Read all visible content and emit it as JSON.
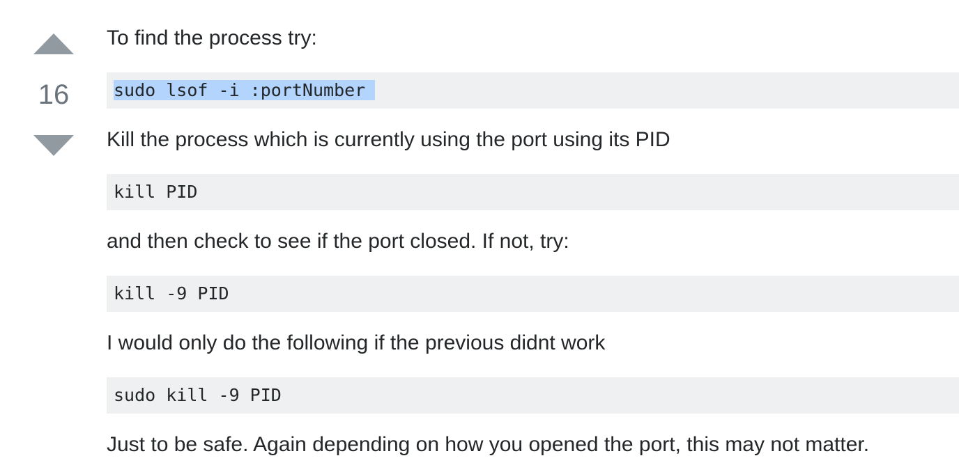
{
  "vote": {
    "score": "16",
    "up_icon": "triangle-up",
    "down_icon": "triangle-down"
  },
  "post": {
    "p1": "To find the process try:",
    "code1": "sudo lsof -i :portNumber",
    "p2": "Kill the process which is currently using the port using its PID",
    "code2": "kill PID",
    "p3": "and then check to see if the port closed. If not, try:",
    "code3": "kill -9 PID",
    "p4": "I would only do the following if the previous didnt work",
    "code4": "sudo kill -9 PID",
    "p5": "Just to be safe. Again depending on how you opened the port, this may not matter."
  },
  "colors": {
    "text": "#242729",
    "code_bg": "#eff0f1",
    "selection": "#b3d4fc",
    "vote_arrow": "#9199a1",
    "vote_count": "#6a737c"
  }
}
